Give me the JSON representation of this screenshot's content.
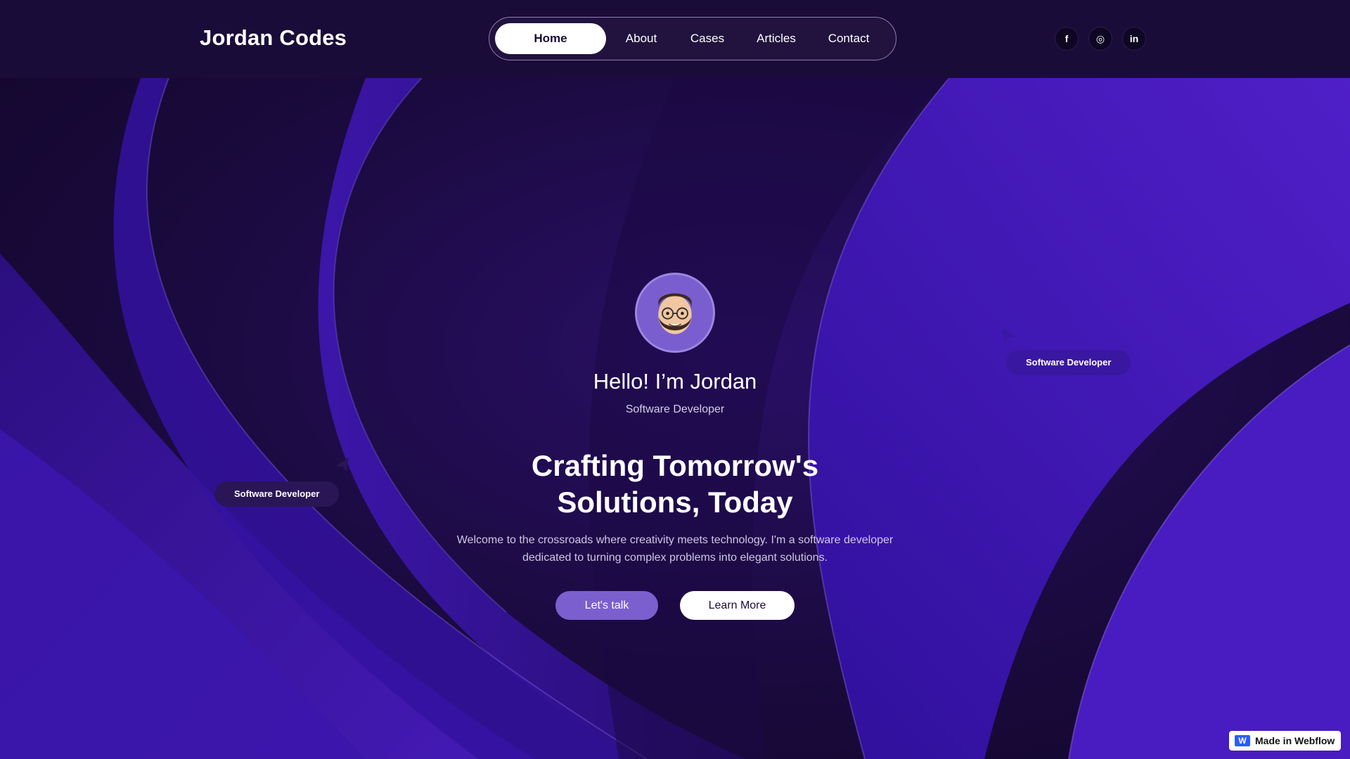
{
  "header": {
    "logo": "Jordan Codes",
    "nav": [
      {
        "label": "Home",
        "active": true
      },
      {
        "label": "About",
        "active": false
      },
      {
        "label": "Cases",
        "active": false
      },
      {
        "label": "Articles",
        "active": false
      },
      {
        "label": "Contact",
        "active": false
      }
    ],
    "socials": [
      {
        "icon": "facebook-icon",
        "glyph": "f"
      },
      {
        "icon": "instagram-icon",
        "glyph": "◎"
      },
      {
        "icon": "linkedin-icon",
        "glyph": "in"
      }
    ]
  },
  "hero": {
    "avatar_icon": "memoji-avatar",
    "greeting": "Hello! I’m Jordan",
    "role": "Software Developer",
    "headline_line1": "Crafting Tomorrow's",
    "headline_line2": "Solutions, Today",
    "intro_line1": "Welcome to the crossroads where creativity meets technology. I'm a software developer",
    "intro_line2": "dedicated to turning complex problems into elegant solutions.",
    "primary_cta": "Let's talk",
    "secondary_cta": "Learn More",
    "floating_tags": [
      "Software Developer",
      "Software Developer"
    ]
  },
  "badge": {
    "label": "Made in Webflow",
    "mark": "W"
  },
  "colors": {
    "header_bg": "#1a0c38",
    "accent": "#7b5fcf",
    "wave_purple": "#4a1cc0",
    "tag_right": "#3a17a0"
  }
}
